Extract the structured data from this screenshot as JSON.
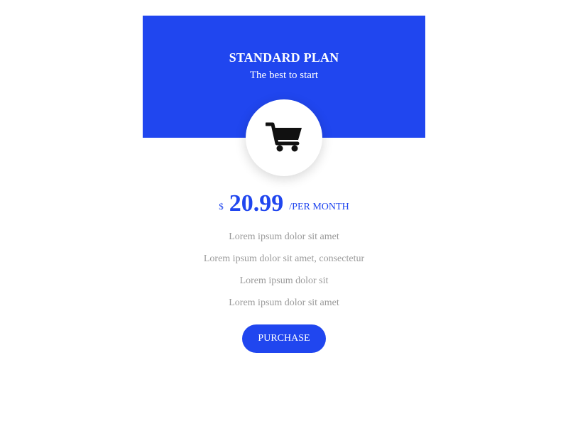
{
  "colors": {
    "accent": "#2046ef",
    "header_text": "#ffffff",
    "feature_text": "#9a9a9a",
    "icon": "#111111"
  },
  "plan": {
    "title": "STANDARD PLAN",
    "subtitle": "The best to start",
    "icon": "shopping-cart-icon"
  },
  "price": {
    "currency": "$",
    "amount": "20.99",
    "period": "/PER MONTH"
  },
  "features": [
    "Lorem ipsum dolor sit amet",
    "Lorem ipsum dolor sit amet, consectetur",
    "Lorem ipsum dolor sit",
    "Lorem ipsum dolor sit amet"
  ],
  "purchase_label": "PURCHASE"
}
